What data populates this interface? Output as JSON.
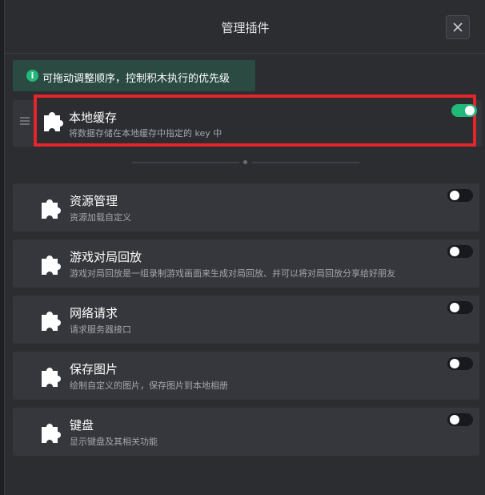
{
  "modal": {
    "title": "管理插件",
    "close_icon": "close-icon"
  },
  "notice": {
    "icon": "info-icon",
    "icon_glyph": "i",
    "text": "可拖动调整顺序，控制积木执行的优先级"
  },
  "colors": {
    "accent": "#22b87a",
    "highlight_border": "#e3262c",
    "card_bg": "#35373c",
    "modal_bg": "#2b2d31"
  },
  "dragging_plugin": {
    "name": "本地缓存",
    "description": "将数据存储在本地缓存中指定的 key 中",
    "enabled": true,
    "icon": "puzzle-icon"
  },
  "plugins": [
    {
      "name": "资源管理",
      "description": "资源加载自定义",
      "enabled": false,
      "icon": "puzzle-icon"
    },
    {
      "name": "游戏对局回放",
      "description": "游戏对局回放是一组录制游戏画面来生成对局回放、并可以将对局回放分享给好朋友",
      "enabled": false,
      "icon": "puzzle-icon"
    },
    {
      "name": "网络请求",
      "description": "请求服务器接口",
      "enabled": false,
      "icon": "puzzle-icon"
    },
    {
      "name": "保存图片",
      "description": "绘制自定义的图片，保存图片到本地相册",
      "enabled": false,
      "icon": "puzzle-icon"
    },
    {
      "name": "键盘",
      "description": "显示键盘及其相关功能",
      "enabled": false,
      "icon": "puzzle-icon"
    }
  ]
}
